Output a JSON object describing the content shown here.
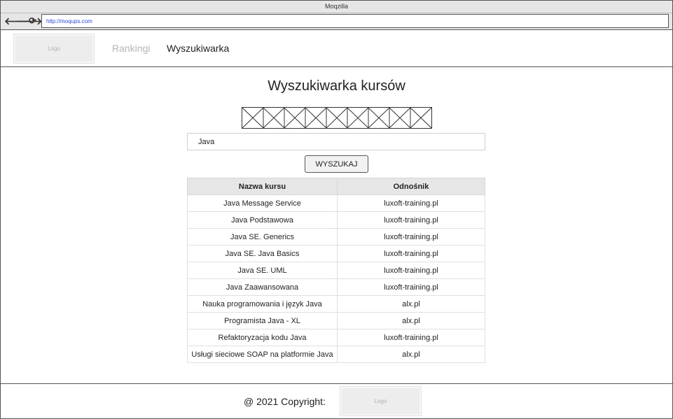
{
  "window": {
    "title": "Moqzilla",
    "url": "http://moqups.com"
  },
  "toolbar": {
    "icons": [
      "back-arrow-icon",
      "forward-arrow-icon",
      "reload-icon"
    ],
    "back_glyph": "🡐",
    "forward_glyph": "🡒",
    "reload_glyph": "⟳"
  },
  "header": {
    "logo_label": "Logo",
    "nav": {
      "rankingi": "Rankingi",
      "wyszukiwarka": "Wyszukiwarka"
    },
    "colors": {
      "inactive_link": "#b5b5b5",
      "active_link": "#222222"
    }
  },
  "main": {
    "title": "Wyszukiwarka kursów",
    "search": {
      "value": "Java",
      "placeholder": "",
      "button_label": "WYSZUKAJ"
    },
    "table": {
      "headers": [
        "Nazwa kursu",
        "Odnośnik"
      ],
      "rows": [
        [
          "Java Message Service",
          "luxoft-training.pl"
        ],
        [
          "Java Podstawowa",
          "luxoft-training.pl"
        ],
        [
          "Java SE. Generics",
          "luxoft-training.pl"
        ],
        [
          "Java SE. Java Basics",
          "luxoft-training.pl"
        ],
        [
          "Java SE. UML",
          "luxoft-training.pl"
        ],
        [
          "Java Zaawansowana",
          "luxoft-training.pl"
        ],
        [
          "Nauka programowania i język Java",
          "alx.pl"
        ],
        [
          "Programista Java - XL",
          "alx.pl"
        ],
        [
          "Refaktoryzacja kodu Java",
          "luxoft-training.pl"
        ],
        [
          "Usługi sieciowe SOAP na platformie Java",
          "alx.pl"
        ]
      ]
    }
  },
  "footer": {
    "copyright": "@ 2021 Copyright:",
    "logo_label": "Logo"
  }
}
